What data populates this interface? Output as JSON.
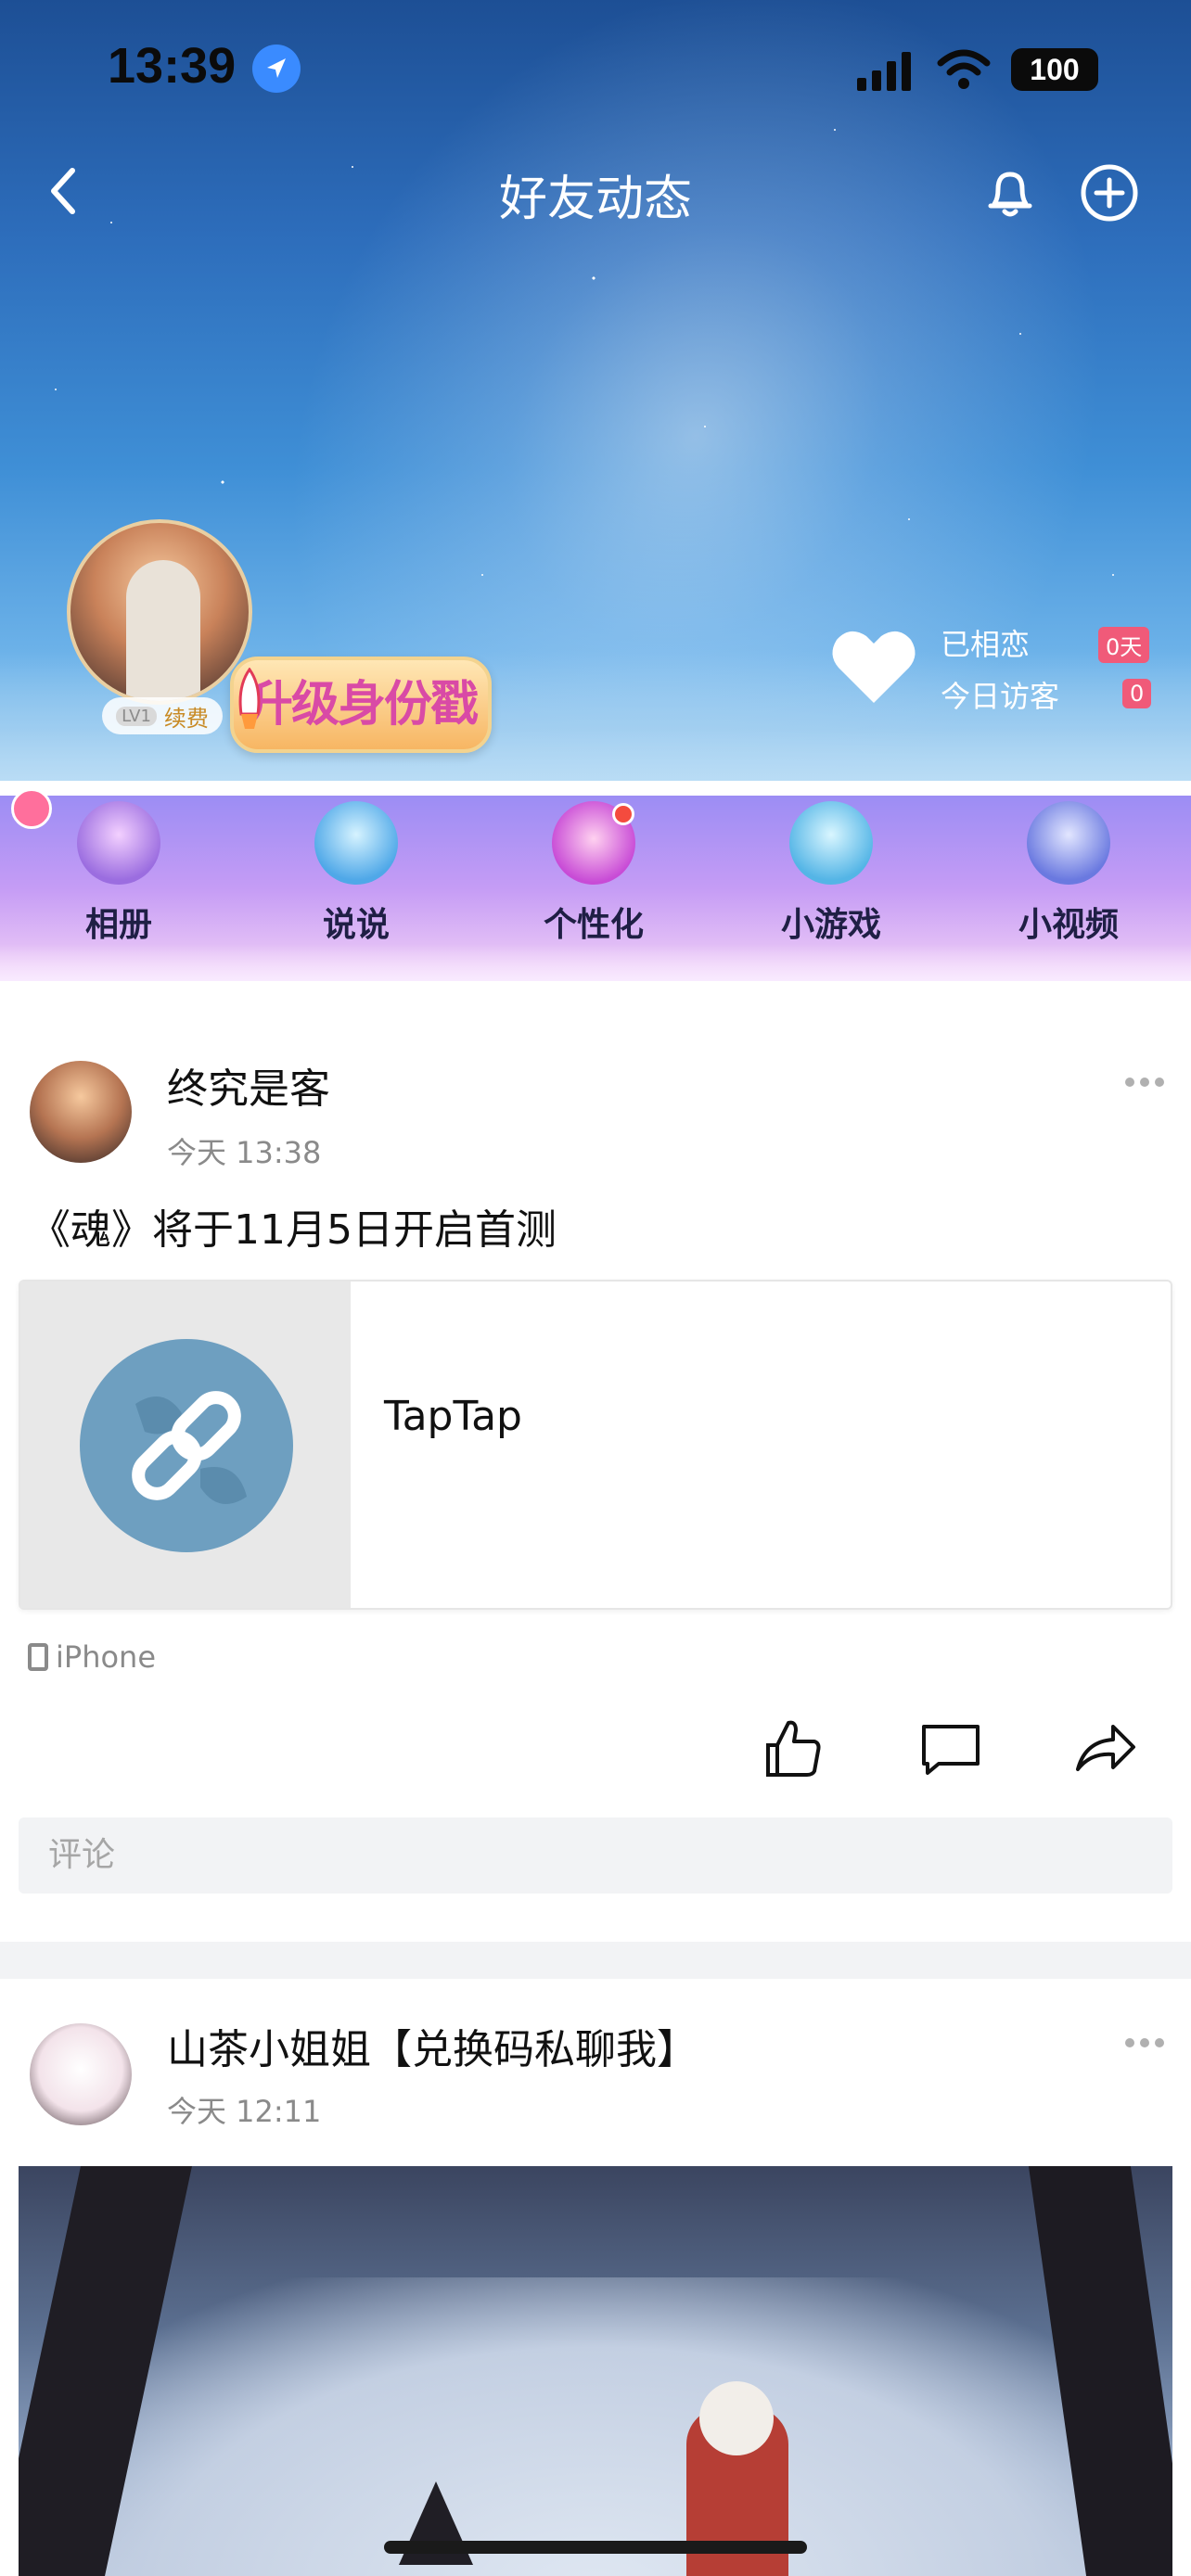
{
  "status_bar": {
    "time": "13:39",
    "battery": "100"
  },
  "nav": {
    "title": "好友动态",
    "back_icon": "chevron-left-icon",
    "bell_icon": "bell-icon",
    "add_icon": "plus-circle-icon"
  },
  "profile": {
    "level": "LV1",
    "renew": "续费",
    "upgrade_banner": "升级身份戳",
    "love_label": "已相恋",
    "love_value": "0天",
    "visitor_label": "今日访客",
    "visitor_value": "0"
  },
  "features": [
    {
      "label": "相册"
    },
    {
      "label": "说说"
    },
    {
      "label": "个性化"
    },
    {
      "label": "小游戏"
    },
    {
      "label": "小视频"
    }
  ],
  "posts": [
    {
      "name": "终究是客",
      "time": "今天 13:38",
      "text": "《魂》将于11月5日开启首测",
      "link_title": "TapTap",
      "device": "iPhone",
      "comment_placeholder": "评论"
    },
    {
      "name": "山茶小姐姐【兑换码私聊我】",
      "time": "今天 12:11"
    }
  ],
  "colors": {
    "accent_badge": "#f05a79",
    "name_text": "#111111",
    "muted": "#8a8a8a"
  }
}
